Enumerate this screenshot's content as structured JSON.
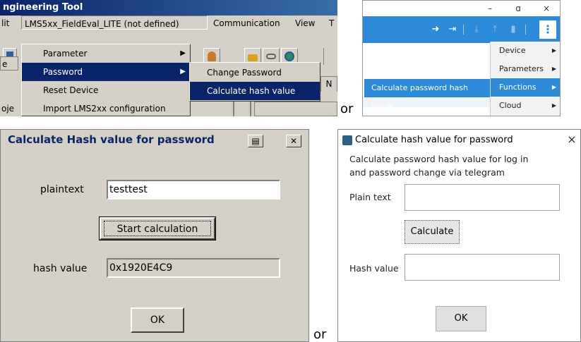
{
  "or_text": "or",
  "classic_menu": {
    "title": "ngineering Tool",
    "menubar": {
      "fragment_left": "lit",
      "device": "LMS5xx_FieldEval_LITE (not defined)",
      "communication": "Communication",
      "view": "View",
      "fragment_right": "T"
    },
    "left_fragments": [
      "e",
      "oje"
    ],
    "dropdown": [
      {
        "label": "Parameter",
        "has_submenu": true,
        "selected": false
      },
      {
        "label": "Password",
        "has_submenu": true,
        "selected": true
      },
      {
        "label": "Reset Device",
        "has_submenu": false,
        "selected": false
      },
      {
        "label": "Import LMS2xx configuration",
        "has_submenu": false,
        "selected": false
      }
    ],
    "submenu": [
      {
        "label": "Change Password",
        "selected": false
      },
      {
        "label": "Calculate hash value",
        "selected": true
      }
    ],
    "selection_color": "#0a246a"
  },
  "modern_menu": {
    "window_controls": [
      "–",
      "ɑ",
      "×"
    ],
    "toolbar_icons": [
      "login-icon",
      "logout-icon",
      "download-icon",
      "upload-icon",
      "delete-icon",
      "more-icon"
    ],
    "kebab": "⋮",
    "left_item": "Calculate password hash value",
    "menu": [
      {
        "label": "Device",
        "selected": false
      },
      {
        "label": "Parameters",
        "selected": false
      },
      {
        "label": "Functions",
        "selected": true
      },
      {
        "label": "Cloud",
        "selected": false
      }
    ],
    "accent_color": "#2c8ad9"
  },
  "classic_dialog": {
    "title": "Calculate Hash value for password",
    "plaintext_label": "plaintext",
    "plaintext_value": "testtest",
    "start_button": "Start calculation",
    "hash_label": "hash value",
    "hash_value": "0x1920E4C9",
    "ok_button": "OK"
  },
  "modern_dialog": {
    "title": "Calculate hash value for password",
    "close": "×",
    "description_line1": "Calculate password hash value for log in",
    "description_line2": "and password change via telegram",
    "plain_text_label": "Plain text",
    "plain_text_value": "",
    "calculate_button": "Calculate",
    "hash_value_label": "Hash value",
    "hash_value_value": "",
    "ok_button": "OK"
  }
}
